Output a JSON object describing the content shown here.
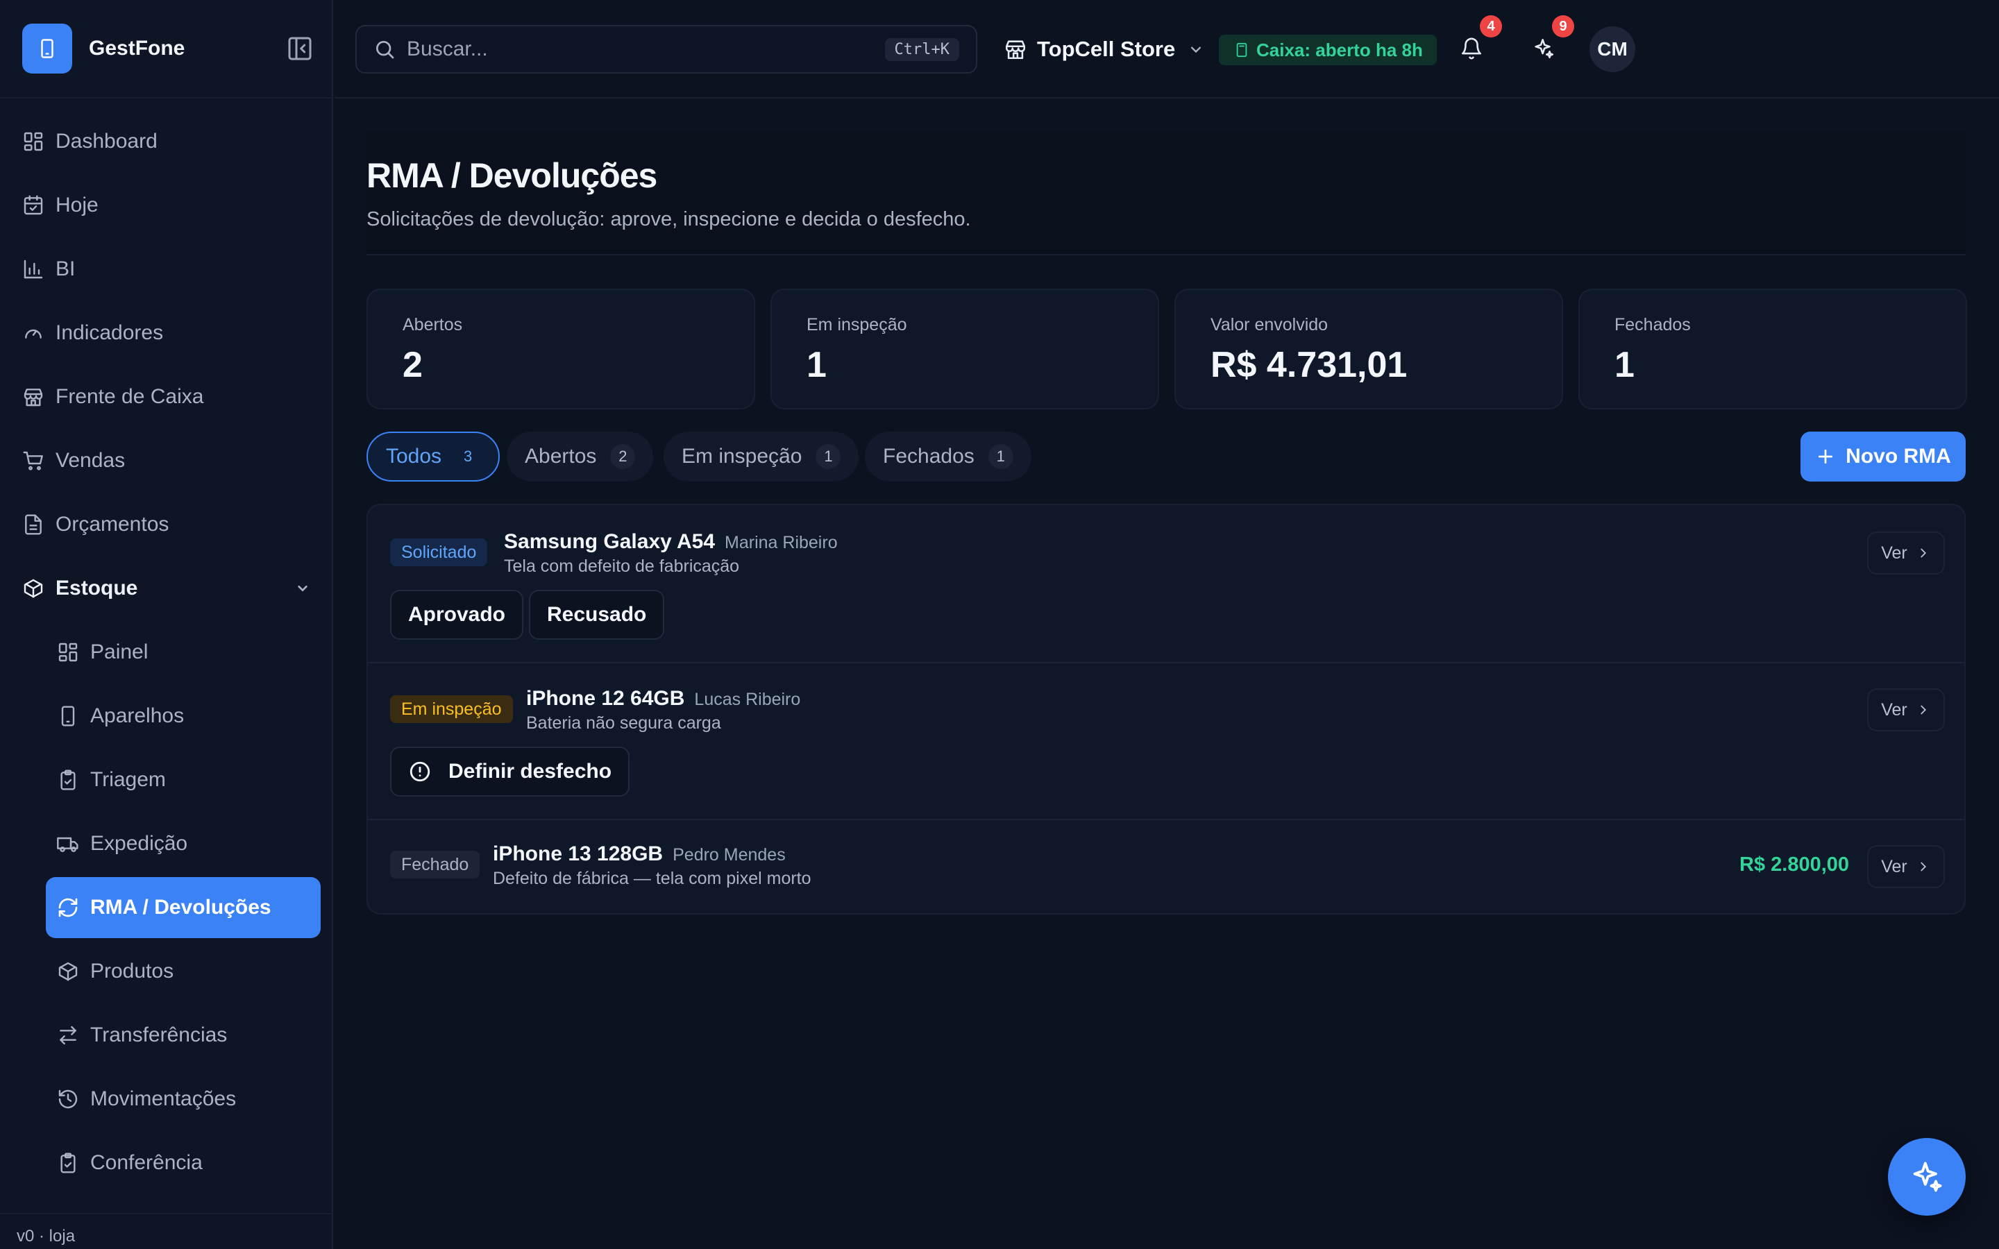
{
  "app": {
    "name": "GestFone",
    "version": "v0 · loja"
  },
  "colors": {
    "accent": "#3b82f6",
    "success": "#34d399",
    "warning": "#fbbf24",
    "danger": "#ef4444",
    "background": "#0b1220"
  },
  "sidebar": {
    "items": [
      {
        "label": "Dashboard",
        "icon": "dashboard-icon"
      },
      {
        "label": "Hoje",
        "icon": "calendar-icon"
      },
      {
        "label": "BI",
        "icon": "bar-chart-icon"
      },
      {
        "label": "Indicadores",
        "icon": "gauge-icon"
      },
      {
        "label": "Frente de Caixa",
        "icon": "store-icon"
      },
      {
        "label": "Vendas",
        "icon": "cart-icon"
      },
      {
        "label": "Orçamentos",
        "icon": "document-icon"
      }
    ],
    "group": {
      "label": "Estoque",
      "icon": "package-icon",
      "expanded": true,
      "items": [
        {
          "label": "Painel",
          "icon": "dashboard-icon"
        },
        {
          "label": "Aparelhos",
          "icon": "smartphone-icon"
        },
        {
          "label": "Triagem",
          "icon": "clipboard-check-icon"
        },
        {
          "label": "Expedição",
          "icon": "truck-icon"
        },
        {
          "label": "RMA / Devoluções",
          "icon": "refresh-icon",
          "active": true
        },
        {
          "label": "Produtos",
          "icon": "package-icon"
        },
        {
          "label": "Transferências",
          "icon": "arrows-swap-icon"
        },
        {
          "label": "Movimentações",
          "icon": "history-icon"
        },
        {
          "label": "Conferência",
          "icon": "clipboard-check-icon"
        }
      ]
    }
  },
  "topbar": {
    "search_placeholder": "Buscar...",
    "search_shortcut": "Ctrl+K",
    "store_name": "TopCell Store",
    "caixa_status": "Caixa: aberto ha 8h",
    "notifications_count": "4",
    "ai_count": "9",
    "user_initials": "CM"
  },
  "page": {
    "title": "RMA / Devoluções",
    "subtitle": "Solicitações de devolução: aprove, inspecione e decida o desfecho."
  },
  "stats": [
    {
      "label": "Abertos",
      "value": "2"
    },
    {
      "label": "Em inspeção",
      "value": "1"
    },
    {
      "label": "Valor envolvido",
      "value": "R$ 4.731,01"
    },
    {
      "label": "Fechados",
      "value": "1"
    }
  ],
  "tabs": [
    {
      "label": "Todos",
      "count": "3",
      "active": true
    },
    {
      "label": "Abertos",
      "count": "2"
    },
    {
      "label": "Em inspeção",
      "count": "1"
    },
    {
      "label": "Fechados",
      "count": "1"
    }
  ],
  "new_button_label": "Novo RMA",
  "rma_list": [
    {
      "status": "Solicitado",
      "device": "Samsung Galaxy A54",
      "customer": "Marina Ribeiro",
      "reason": "Tela com defeito de fabricação",
      "actions": [
        "Aprovado",
        "Recusado"
      ],
      "view_label": "Ver"
    },
    {
      "status": "Em inspeção",
      "device": "iPhone 12 64GB",
      "customer": "Lucas Ribeiro",
      "reason": "Bateria não segura carga",
      "actions": [
        "Definir desfecho"
      ],
      "view_label": "Ver"
    },
    {
      "status": "Fechado",
      "device": "iPhone 13 128GB",
      "customer": "Pedro Mendes",
      "reason": "Defeito de fábrica — tela com pixel morto",
      "amount": "R$ 2.800,00",
      "view_label": "Ver"
    }
  ]
}
